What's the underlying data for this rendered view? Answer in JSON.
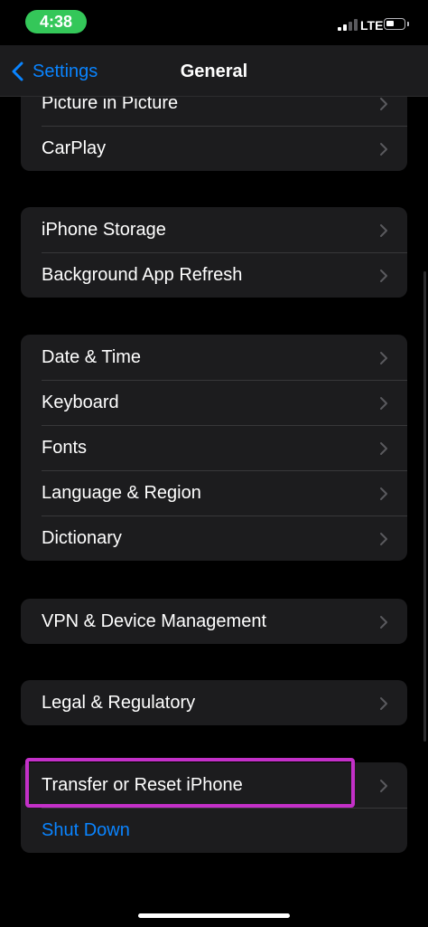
{
  "status_bar": {
    "time": "4:38",
    "network": "LTE",
    "signal_bars": 4,
    "signal_bars_filled": 2,
    "battery_level": 0.45
  },
  "nav": {
    "back_label": "Settings",
    "title": "General"
  },
  "groups": [
    {
      "rows": [
        {
          "label": "Picture in Picture"
        },
        {
          "label": "CarPlay"
        }
      ]
    },
    {
      "rows": [
        {
          "label": "iPhone Storage"
        },
        {
          "label": "Background App Refresh"
        }
      ]
    },
    {
      "rows": [
        {
          "label": "Date & Time"
        },
        {
          "label": "Keyboard"
        },
        {
          "label": "Fonts"
        },
        {
          "label": "Language & Region"
        },
        {
          "label": "Dictionary"
        }
      ]
    },
    {
      "rows": [
        {
          "label": "VPN & Device Management"
        }
      ]
    },
    {
      "rows": [
        {
          "label": "Legal & Regulatory"
        }
      ]
    },
    {
      "rows": [
        {
          "label": "Transfer or Reset iPhone"
        },
        {
          "label": "Shut Down"
        }
      ]
    }
  ],
  "colors": {
    "accent": "#0a84ff",
    "highlight": "#c330c8",
    "time_pill": "#34c759",
    "group_bg": "#1c1c1e"
  }
}
